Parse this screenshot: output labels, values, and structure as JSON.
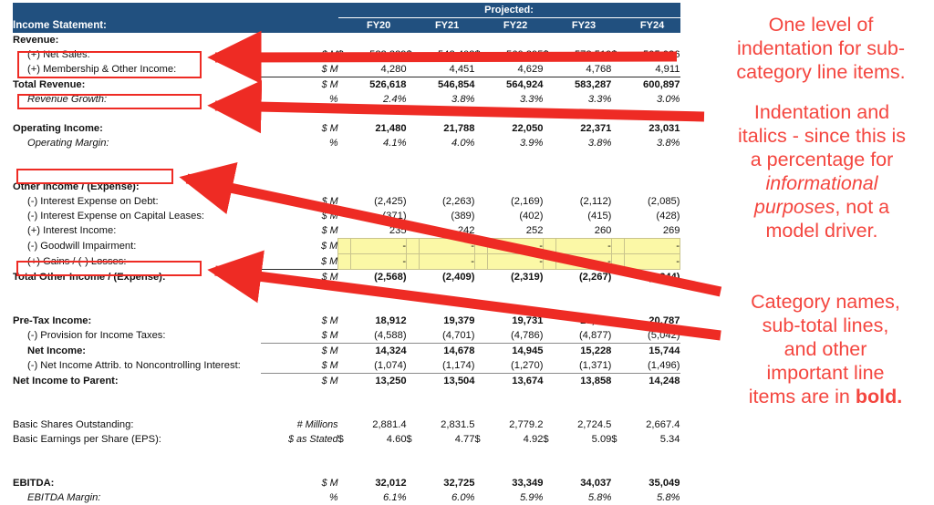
{
  "header": {
    "title": "Income Statement:",
    "projected_label": "Projected:",
    "years": [
      "FY20",
      "FY21",
      "FY22",
      "FY23",
      "FY24"
    ],
    "band_color": "#21507f"
  },
  "colors": {
    "annotation_red": "#f4463f",
    "box_red": "#ee2b24",
    "highlight_yellow": "#fbf8a6"
  },
  "rows": [
    {
      "id": "revenue-header",
      "label": "Revenue:",
      "unit": "",
      "values": [
        "",
        "",
        "",
        "",
        ""
      ]
    },
    {
      "id": "net-sales",
      "label": "(+) Net Sales:",
      "unit": "$ M",
      "currency": "$",
      "values": [
        "522,339",
        "542,403",
        "560,295",
        "578,519",
        "595,986"
      ]
    },
    {
      "id": "membership-other-income",
      "label": "(+) Membership & Other Income:",
      "unit": "$ M",
      "values": [
        "4,280",
        "4,451",
        "4,629",
        "4,768",
        "4,911"
      ]
    },
    {
      "id": "total-revenue",
      "label": "Total Revenue:",
      "unit": "$ M",
      "values": [
        "526,618",
        "546,854",
        "564,924",
        "583,287",
        "600,897"
      ]
    },
    {
      "id": "revenue-growth",
      "label": "Revenue Growth:",
      "unit": "%",
      "values": [
        "2.4%",
        "3.8%",
        "3.3%",
        "3.3%",
        "3.0%"
      ]
    },
    {
      "id": "operating-income",
      "label": "Operating Income:",
      "unit": "$ M",
      "values": [
        "21,480",
        "21,788",
        "22,050",
        "22,371",
        "23,031"
      ]
    },
    {
      "id": "operating-margin",
      "label": "Operating Margin:",
      "unit": "%",
      "values": [
        "4.1%",
        "4.0%",
        "3.9%",
        "3.8%",
        "3.8%"
      ]
    },
    {
      "id": "other-income-expense-header",
      "label": "Other Income / (Expense):",
      "unit": "",
      "values": [
        "",
        "",
        "",
        "",
        ""
      ]
    },
    {
      "id": "interest-expense-debt",
      "label": "(-) Interest Expense on Debt:",
      "unit": "$ M",
      "values": [
        "(2,425)",
        "(2,263)",
        "(2,169)",
        "(2,112)",
        "(2,085)"
      ]
    },
    {
      "id": "interest-expense-capital-leases",
      "label": "(-) Interest Expense on Capital Leases:",
      "unit": "$ M",
      "values": [
        "(371)",
        "(389)",
        "(402)",
        "(415)",
        "(428)"
      ]
    },
    {
      "id": "interest-income",
      "label": "(+) Interest Income:",
      "unit": "$ M",
      "values": [
        "235",
        "242",
        "252",
        "260",
        "269"
      ]
    },
    {
      "id": "goodwill-impairment",
      "label": "(-) Goodwill Impairment:",
      "unit": "$ M",
      "values": [
        "-",
        "-",
        "-",
        "-",
        "-"
      ]
    },
    {
      "id": "gains-losses",
      "label": "(+) Gains / (-) Losses:",
      "unit": "$ M",
      "values": [
        "-",
        "-",
        "-",
        "-",
        "-"
      ]
    },
    {
      "id": "total-other-income-expense",
      "label": "Total Other Income / (Expense):",
      "unit": "$ M",
      "values": [
        "(2,568)",
        "(2,409)",
        "(2,319)",
        "(2,267)",
        "(2,244)"
      ]
    },
    {
      "id": "pre-tax-income",
      "label": "Pre-Tax Income:",
      "unit": "$ M",
      "values": [
        "18,912",
        "19,379",
        "19,731",
        "20,105",
        "20,787"
      ]
    },
    {
      "id": "provision-income-taxes",
      "label": "(-) Provision for Income Taxes:",
      "unit": "$ M",
      "values": [
        "(4,588)",
        "(4,701)",
        "(4,786)",
        "(4,877)",
        "(5,042)"
      ]
    },
    {
      "id": "net-income",
      "label": "Net Income:",
      "unit": "$ M",
      "values": [
        "14,324",
        "14,678",
        "14,945",
        "15,228",
        "15,744"
      ]
    },
    {
      "id": "net-income-noncontrolling",
      "label": "(-) Net Income Attrib. to Noncontrolling Interest:",
      "unit": "$ M",
      "values": [
        "(1,074)",
        "(1,174)",
        "(1,270)",
        "(1,371)",
        "(1,496)"
      ]
    },
    {
      "id": "net-income-to-parent",
      "label": "Net Income to Parent:",
      "unit": "$ M",
      "values": [
        "13,250",
        "13,504",
        "13,674",
        "13,858",
        "14,248"
      ]
    },
    {
      "id": "basic-shares-outstanding",
      "label": "Basic Shares Outstanding:",
      "unit": "# Millions",
      "values": [
        "2,881.4",
        "2,831.5",
        "2,779.2",
        "2,724.5",
        "2,667.4"
      ]
    },
    {
      "id": "basic-eps",
      "label": "Basic Earnings per Share (EPS):",
      "unit": "$ as Stated",
      "currency": "$",
      "values": [
        "4.60",
        "4.77",
        "4.92",
        "5.09",
        "5.34"
      ]
    },
    {
      "id": "ebitda",
      "label": "EBITDA:",
      "unit": "$ M",
      "values": [
        "32,012",
        "32,725",
        "33,349",
        "34,037",
        "35,049"
      ]
    },
    {
      "id": "ebitda-margin",
      "label": "EBITDA Margin:",
      "unit": "%",
      "values": [
        "6.1%",
        "6.0%",
        "5.9%",
        "5.8%",
        "5.8%"
      ]
    }
  ],
  "annotations": {
    "note1_line1": "One level of",
    "note1_line2": "indentation for sub-",
    "note1_line3": "category line items.",
    "note2_line1": "Indentation and",
    "note2_line2": "italics - since this is",
    "note2_line3": "a percentage for",
    "note2_line4_em": "informational",
    "note2_line5_em": "purposes",
    "note2_line5_rest": ", not a",
    "note2_line6": "model driver.",
    "note3_line1": "Category names,",
    "note3_line2": "sub-total lines,",
    "note3_line3": "and other",
    "note3_line4": "important line",
    "note3_line5_rest": "items are in ",
    "note3_line5_strong": "bold."
  }
}
